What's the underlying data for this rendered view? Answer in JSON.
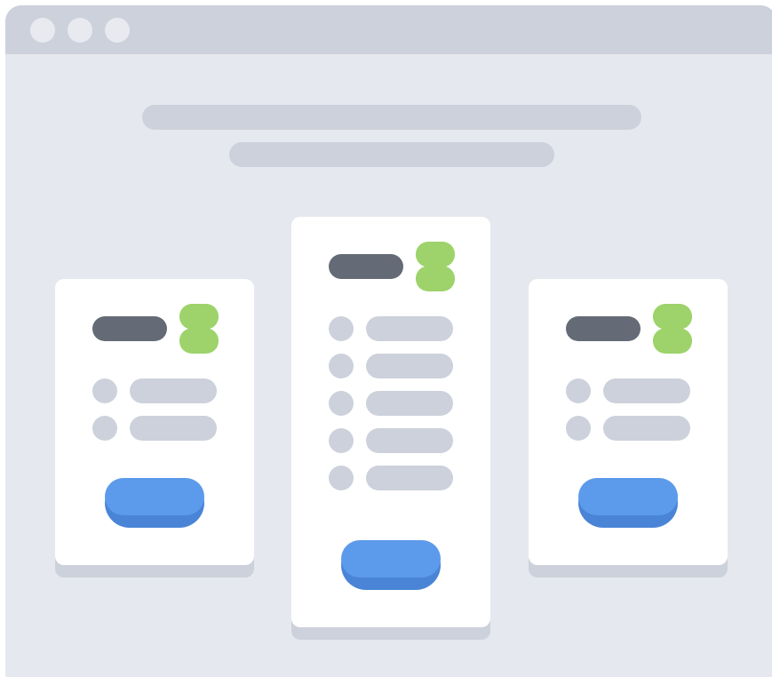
{
  "window": {
    "titlebar": {
      "controls": [
        "window-dot",
        "window-dot",
        "window-dot"
      ]
    }
  },
  "colors": {
    "window_bg": "#e5e8ee",
    "titlebar": "#ccd1db",
    "placeholder": "#ccd1db",
    "title_placeholder": "#646b76",
    "price_icon": "#9dd36a",
    "button": "#5c9aeb",
    "button_shadow": "#4a84d6",
    "card": "#ffffff"
  },
  "header": {
    "title_placeholder": "",
    "subtitle_placeholder": ""
  },
  "plans": [
    {
      "position": "left",
      "icon": "price-tag-icon",
      "features": 2,
      "button_icon": "cta-button"
    },
    {
      "position": "center",
      "featured": true,
      "icon": "price-tag-icon",
      "features": 5,
      "button_icon": "cta-button"
    },
    {
      "position": "right",
      "icon": "price-tag-icon",
      "features": 2,
      "button_icon": "cta-button"
    }
  ]
}
